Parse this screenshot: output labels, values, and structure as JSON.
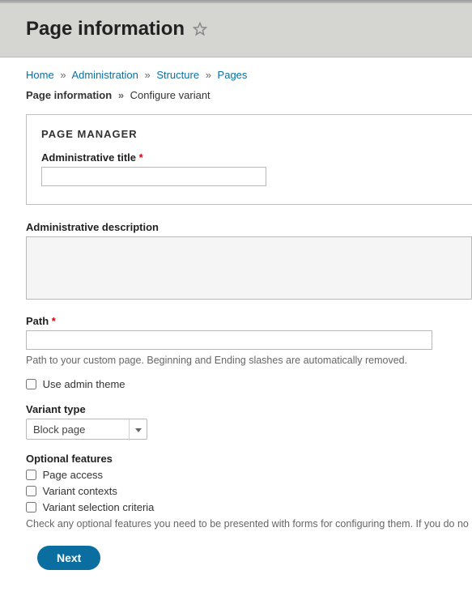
{
  "header": {
    "title": "Page information"
  },
  "breadcrumb": {
    "items": [
      "Home",
      "Administration",
      "Structure",
      "Pages"
    ],
    "sep": "»"
  },
  "subtrail": {
    "current": "Page information",
    "sep": "»",
    "action": "Configure variant"
  },
  "panel": {
    "title": "PAGE MANAGER",
    "admin_title_label": "Administrative title",
    "admin_title_value": ""
  },
  "admin_desc": {
    "label": "Administrative description",
    "value": ""
  },
  "path": {
    "label": "Path",
    "value": "",
    "help": "Path to your custom page. Beginning and Ending slashes are automatically removed."
  },
  "use_admin_theme": {
    "label": "Use admin theme",
    "checked": false
  },
  "variant_type": {
    "label": "Variant type",
    "selected": "Block page"
  },
  "optional": {
    "label": "Optional features",
    "items": [
      "Page access",
      "Variant contexts",
      "Variant selection criteria"
    ],
    "help": "Check any optional features you need to be presented with forms for configuring them. If you do no"
  },
  "buttons": {
    "next": "Next"
  }
}
